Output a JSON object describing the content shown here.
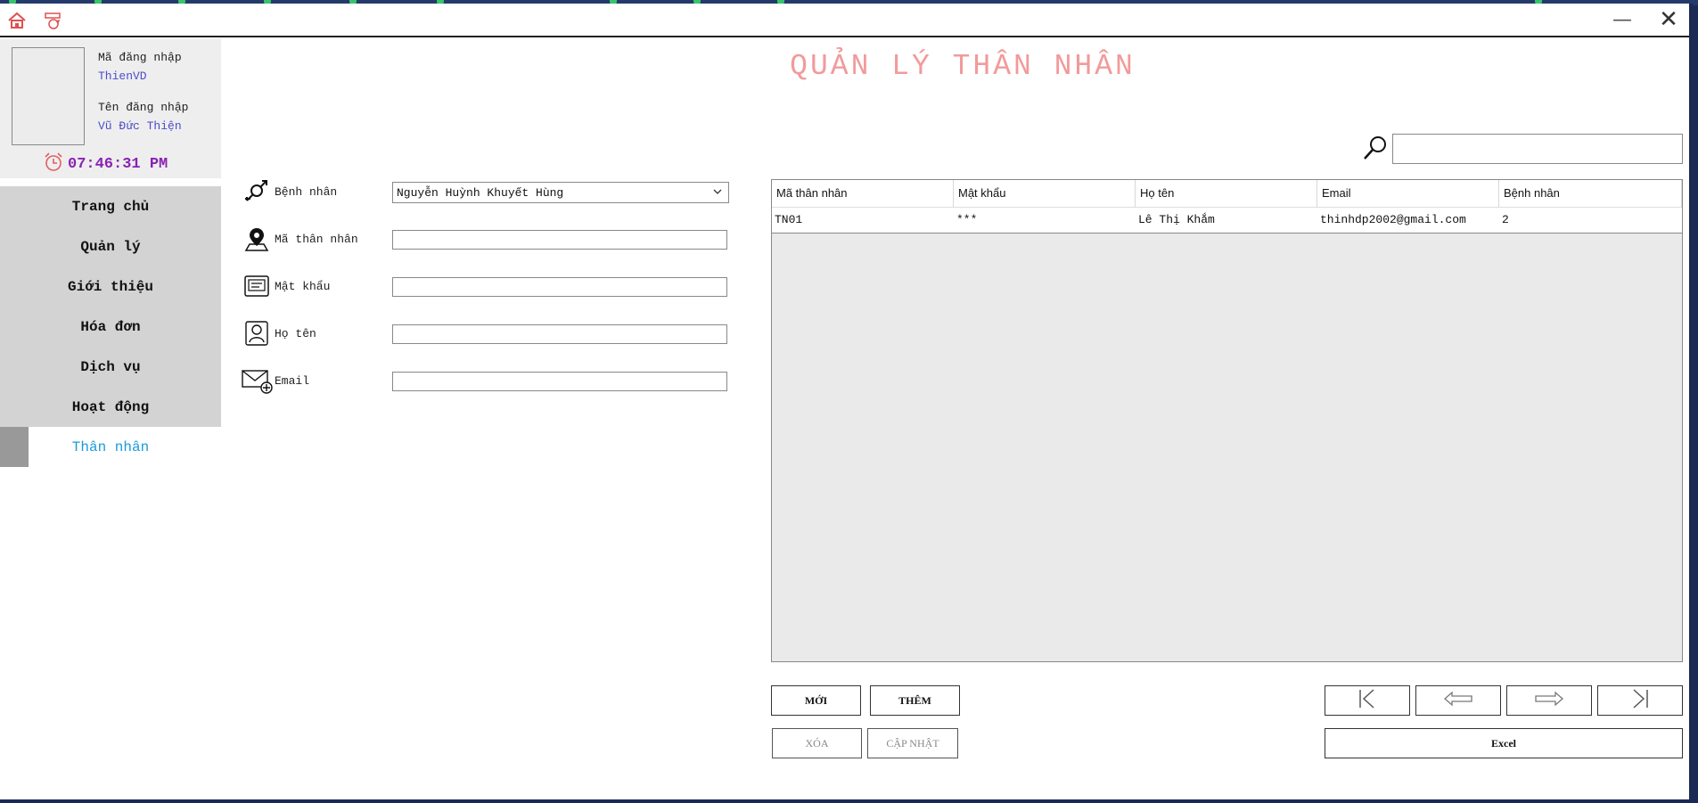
{
  "window": {
    "minimize_glyph": "—",
    "close_glyph": "✕"
  },
  "user": {
    "login_code_label": "Mã đăng nhập",
    "login_code": "ThienVD",
    "login_name_label": "Tên đăng nhập",
    "login_name": "Vũ Đức Thiện",
    "clock_time": "07:46:31 PM"
  },
  "nav": {
    "items": [
      "Trang chủ",
      "Quản lý",
      "Giới thiệu",
      "Hóa đơn",
      "Dịch vụ",
      "Hoạt động"
    ],
    "active": "Thân nhân"
  },
  "page_title": "QUẢN LÝ THÂN NHÂN",
  "form": {
    "patient_label": "Bệnh nhân",
    "patient_value": "Nguyễn Huỳnh Khuyết Hùng",
    "relative_id_label": "Mã thân nhân",
    "relative_id_value": "",
    "password_label": "Mật khẩu",
    "password_value": "",
    "fullname_label": "Họ tên",
    "fullname_value": "",
    "email_label": "Email",
    "email_value": ""
  },
  "search": {
    "value": ""
  },
  "grid": {
    "columns": [
      "Mã thân nhân",
      "Mật khẩu",
      "Họ tên",
      "Email",
      "Bệnh nhân"
    ],
    "rows": [
      [
        "TN01",
        "***",
        "Lê Thị Khắm",
        "thinhdp2002@gmail.com",
        "2"
      ]
    ]
  },
  "buttons": {
    "new": "MỚI",
    "add": "THÊM",
    "delete": "XÓA",
    "update": "CẬP NHẬT",
    "excel": "Excel"
  },
  "colors": {
    "title": "#f29a9a",
    "clock": "#8a22b4",
    "user_value": "#4c4ccc",
    "nav_active": "#1a9bd8",
    "nav_bg": "#d3d3d3"
  }
}
